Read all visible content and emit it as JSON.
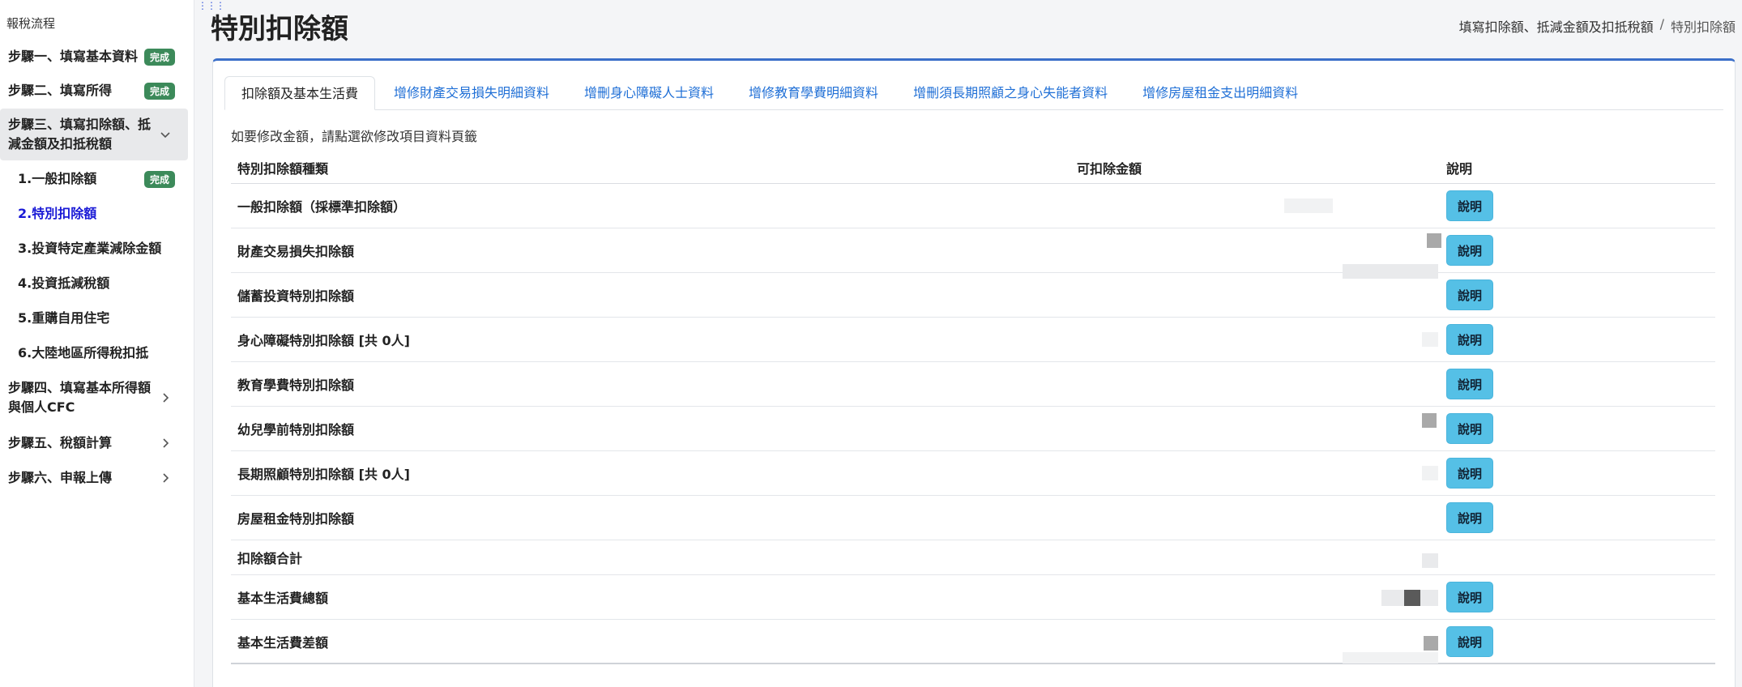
{
  "sidebar": {
    "title": "報稅流程",
    "steps": [
      {
        "label": "步驟一、填寫基本資料",
        "badge": "完成"
      },
      {
        "label": "步驟二、填寫所得",
        "badge": "完成"
      },
      {
        "label": "步驟三、填寫扣除額、抵減金額及扣抵稅額",
        "expanded": true
      },
      {
        "label": "1.一般扣除額",
        "badge": "完成"
      },
      {
        "label": "2.特別扣除額",
        "current": true
      },
      {
        "label": "3.投資特定產業減除金額"
      },
      {
        "label": "4.投資抵減稅額"
      },
      {
        "label": "5.重購自用住宅"
      },
      {
        "label": "6.大陸地區所得稅扣抵"
      },
      {
        "label": "步驟四、填寫基本所得額與個人CFC"
      },
      {
        "label": "步驟五、稅額計算"
      },
      {
        "label": "步驟六、申報上傳"
      }
    ],
    "step3_line1": "步驟三、填寫扣除額、抵",
    "step3_line2": "減金額及扣抵稅額",
    "step4_line1": "步驟四、填寫基本所得額",
    "step4_line2": "與個人CFC"
  },
  "header": {
    "title": "特別扣除額",
    "breadcrumb": [
      "填寫扣除額、抵減金額及扣抵稅額",
      "/",
      "特別扣除額"
    ]
  },
  "tabs": [
    "扣除額及基本生活費",
    "增修財產交易損失明細資料",
    "增刪身心障礙人士資料",
    "增修教育學費明細資料",
    "增刪須長期照顧之身心失能者資料",
    "增修房屋租金支出明細資料"
  ],
  "hint": "如要修改金額，請點選欲修改項目資料頁籤",
  "table": {
    "headers": [
      "特別扣除額種類",
      "可扣除金額",
      "說明"
    ],
    "button_label": "說明",
    "rows": [
      "一般扣除額（採標準扣除額）",
      "財產交易損失扣除額",
      "儲蓄投資特別扣除額",
      "身心障礙特別扣除額 [共 0人]",
      "教育學費特別扣除額",
      "幼兒學前特別扣除額",
      "長期照顧特別扣除額 [共 0人]",
      "房屋租金特別扣除額",
      "扣除額合計",
      "基本生活費總額",
      "基本生活費差額"
    ]
  },
  "colors": {
    "accent": "#3b6fc9",
    "badge": "#3c8a5a",
    "info_button": "#55c0e6",
    "current_step": "#1a1ad6"
  }
}
